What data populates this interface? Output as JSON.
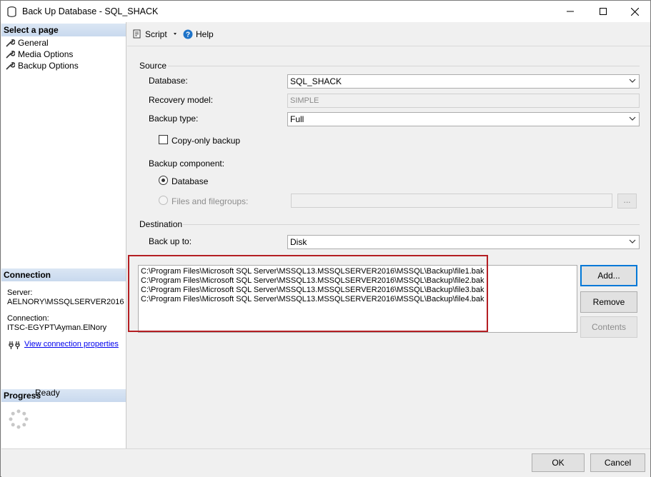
{
  "window": {
    "title": "Back Up Database - SQL_SHACK"
  },
  "select_page": {
    "heading": "Select a page",
    "items": [
      {
        "label": "General",
        "icon": "wrench-icon"
      },
      {
        "label": "Media Options",
        "icon": "wrench-icon"
      },
      {
        "label": "Backup Options",
        "icon": "wrench-icon"
      }
    ]
  },
  "connection": {
    "heading": "Connection",
    "server_label": "Server:",
    "server_value": "AELNORY\\MSSQLSERVER2016",
    "connection_label": "Connection:",
    "connection_value": "ITSC-EGYPT\\Ayman.ElNory",
    "link": "View connection properties"
  },
  "progress": {
    "heading": "Progress",
    "status": "Ready"
  },
  "toolbar": {
    "script_label": "Script",
    "help_label": "Help"
  },
  "source": {
    "group_label": "Source",
    "database_label": "Database:",
    "database_value": "SQL_SHACK",
    "recovery_label": "Recovery model:",
    "recovery_value": "SIMPLE",
    "backup_type_label": "Backup type:",
    "backup_type_value": "Full",
    "copy_only_label": "Copy-only backup",
    "component_label": "Backup component:",
    "component_database": "Database",
    "component_files": "Files and filegroups:",
    "files_button": "..."
  },
  "destination": {
    "group_label": "Destination",
    "backup_to_label": "Back up to:",
    "backup_to_value": "Disk",
    "files": [
      "C:\\Program Files\\Microsoft SQL Server\\MSSQL13.MSSQLSERVER2016\\MSSQL\\Backup\\file1.bak",
      "C:\\Program Files\\Microsoft SQL Server\\MSSQL13.MSSQLSERVER2016\\MSSQL\\Backup\\file2.bak",
      "C:\\Program Files\\Microsoft SQL Server\\MSSQL13.MSSQLSERVER2016\\MSSQL\\Backup\\file3.bak",
      "C:\\Program Files\\Microsoft SQL Server\\MSSQL13.MSSQLSERVER2016\\MSSQL\\Backup\\file4.bak"
    ],
    "add_button": "Add...",
    "remove_button": "Remove",
    "contents_button": "Contents"
  },
  "footer": {
    "ok_button": "OK",
    "cancel_button": "Cancel"
  },
  "colors": {
    "highlight": "#b41e23",
    "section_header": "#d2e0f2",
    "link": "#0000ee",
    "accent": "#0078d7"
  }
}
